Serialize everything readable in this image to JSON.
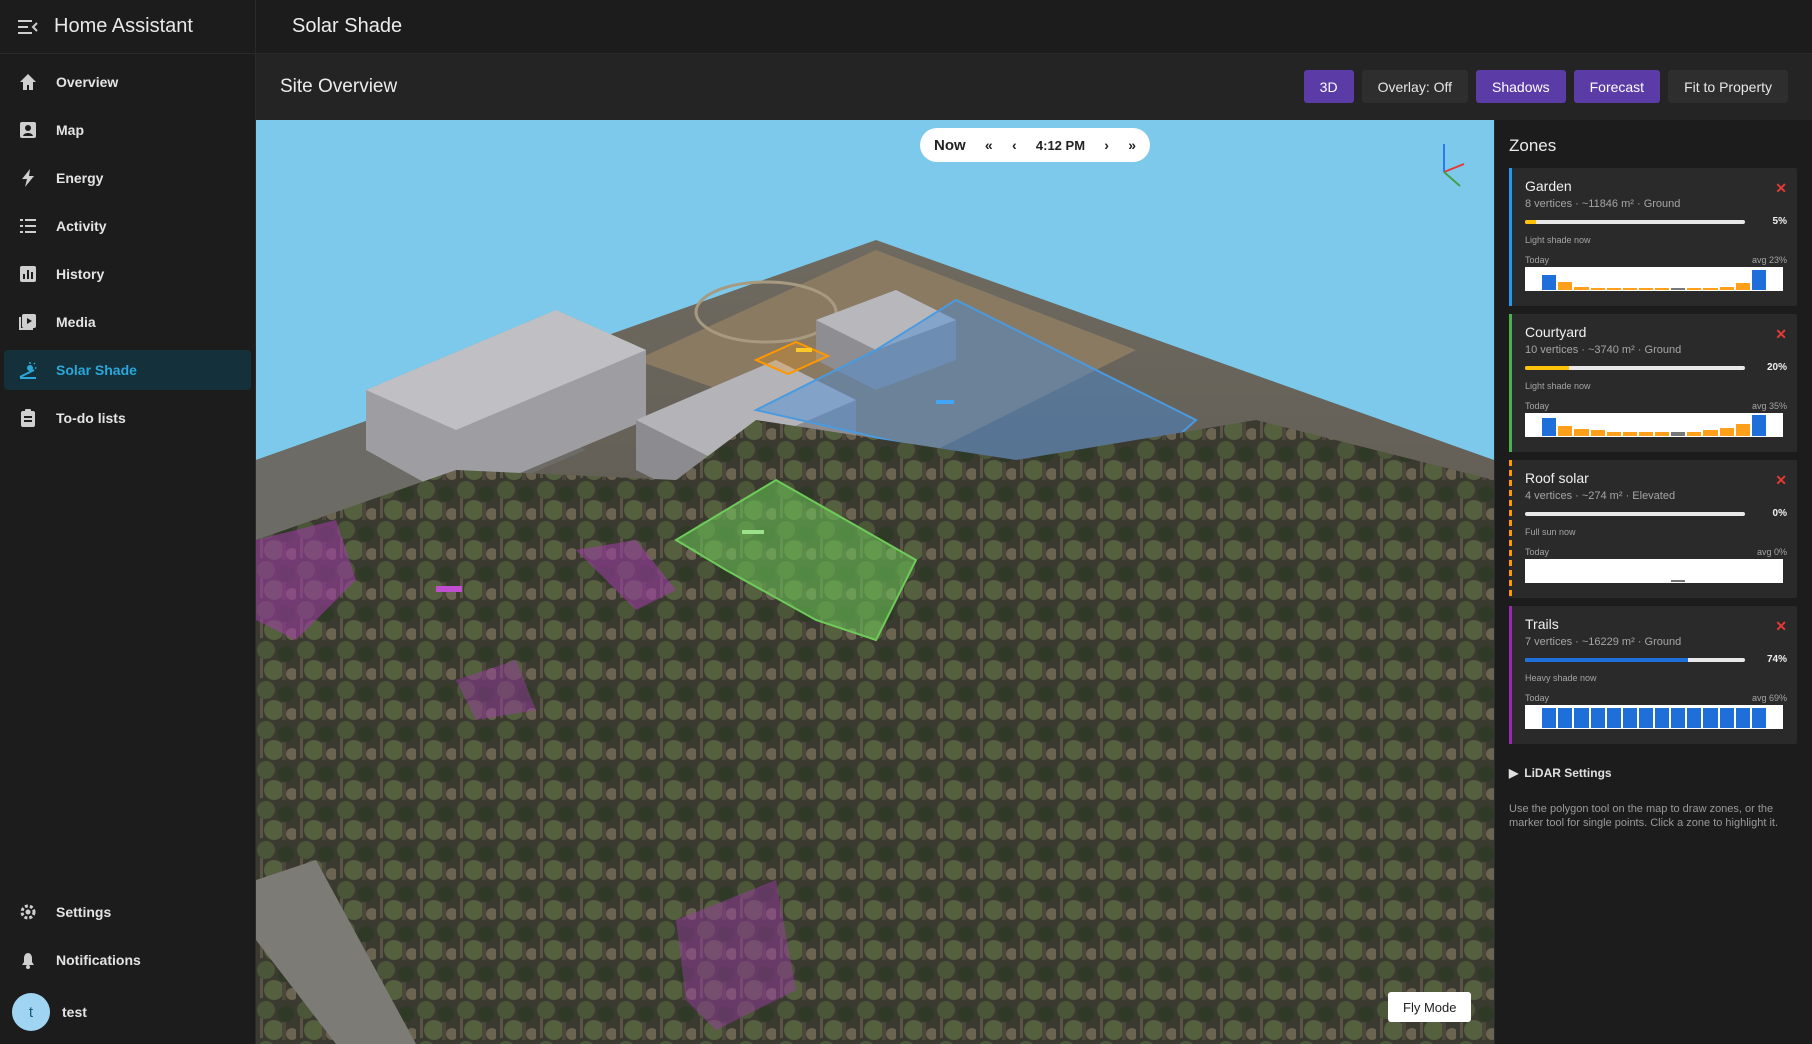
{
  "app": {
    "title": "Home Assistant"
  },
  "sidebar": {
    "items": [
      {
        "label": "Overview",
        "icon": "home-icon"
      },
      {
        "label": "Map",
        "icon": "map-icon"
      },
      {
        "label": "Energy",
        "icon": "lightning-icon"
      },
      {
        "label": "Activity",
        "icon": "list-icon"
      },
      {
        "label": "History",
        "icon": "chart-icon"
      },
      {
        "label": "Media",
        "icon": "media-icon"
      },
      {
        "label": "Solar Shade",
        "icon": "sun-shade-icon",
        "active": true
      },
      {
        "label": "To-do lists",
        "icon": "clipboard-icon"
      }
    ],
    "bottom": [
      {
        "label": "Settings",
        "icon": "gear-icon"
      },
      {
        "label": "Notifications",
        "icon": "bell-icon"
      }
    ],
    "user": {
      "initial": "t",
      "name": "test"
    }
  },
  "topbar": {
    "title": "Solar Shade"
  },
  "subbar": {
    "title": "Site Overview",
    "buttons": [
      {
        "label": "3D",
        "style": "purple"
      },
      {
        "label": "Overlay: Off",
        "style": "plain"
      },
      {
        "label": "Shadows",
        "style": "purple"
      },
      {
        "label": "Forecast",
        "style": "purple"
      },
      {
        "label": "Fit to Property",
        "style": "plain"
      }
    ]
  },
  "timebar": {
    "now": "Now",
    "fast_back": "«",
    "back": "‹",
    "time": "4:12 PM",
    "forward": "›",
    "fast_forward": "»"
  },
  "map": {
    "fly_mode": "Fly Mode"
  },
  "panel": {
    "title": "Zones",
    "zones": [
      {
        "name": "Garden",
        "meta": "8 vertices · ~11846 m² · Ground",
        "percent": 5,
        "pct_label": "5%",
        "status": "Light shade now",
        "today": "Today",
        "avg": "avg 23%",
        "color": "#2196f3",
        "fill": "#ffc107",
        "dashed": false,
        "spark": [
          {
            "v": 0.0,
            "c": "b"
          },
          {
            "v": 0.7,
            "c": "b"
          },
          {
            "v": 0.35,
            "c": "o"
          },
          {
            "v": 0.15,
            "c": "o"
          },
          {
            "v": 0.1,
            "c": "o"
          },
          {
            "v": 0.05,
            "c": "o"
          },
          {
            "v": 0.05,
            "c": "o"
          },
          {
            "v": 0.05,
            "c": "o"
          },
          {
            "v": 0.05,
            "c": "o"
          },
          {
            "v": 0.05,
            "c": "g"
          },
          {
            "v": 0.08,
            "c": "o"
          },
          {
            "v": 0.1,
            "c": "o"
          },
          {
            "v": 0.15,
            "c": "o"
          },
          {
            "v": 0.3,
            "c": "o"
          },
          {
            "v": 0.9,
            "c": "b"
          },
          {
            "v": 0.0,
            "c": "b"
          }
        ]
      },
      {
        "name": "Courtyard",
        "meta": "10 vertices · ~3740 m² · Ground",
        "percent": 20,
        "pct_label": "20%",
        "status": "Light shade now",
        "today": "Today",
        "avg": "avg 35%",
        "color": "#4caf50",
        "fill": "#ffc107",
        "dashed": false,
        "spark": [
          {
            "v": 0.0,
            "c": "b"
          },
          {
            "v": 0.8,
            "c": "b"
          },
          {
            "v": 0.45,
            "c": "o"
          },
          {
            "v": 0.3,
            "c": "o"
          },
          {
            "v": 0.25,
            "c": "o"
          },
          {
            "v": 0.2,
            "c": "o"
          },
          {
            "v": 0.2,
            "c": "o"
          },
          {
            "v": 0.2,
            "c": "o"
          },
          {
            "v": 0.2,
            "c": "o"
          },
          {
            "v": 0.2,
            "c": "g"
          },
          {
            "v": 0.2,
            "c": "o"
          },
          {
            "v": 0.25,
            "c": "o"
          },
          {
            "v": 0.35,
            "c": "o"
          },
          {
            "v": 0.55,
            "c": "o"
          },
          {
            "v": 0.95,
            "c": "b"
          },
          {
            "v": 0.0,
            "c": "b"
          }
        ]
      },
      {
        "name": "Roof solar",
        "meta": "4 vertices · ~274 m² · Elevated",
        "percent": 0,
        "pct_label": "0%",
        "status": "Full sun now",
        "today": "Today",
        "avg": "avg 0%",
        "color": "#ff9800",
        "fill": "#ffc107",
        "dashed": true,
        "spark": [
          {
            "v": 0,
            "c": "o"
          },
          {
            "v": 0,
            "c": "o"
          },
          {
            "v": 0,
            "c": "o"
          },
          {
            "v": 0,
            "c": "o"
          },
          {
            "v": 0,
            "c": "o"
          },
          {
            "v": 0,
            "c": "o"
          },
          {
            "v": 0,
            "c": "o"
          },
          {
            "v": 0,
            "c": "o"
          },
          {
            "v": 0,
            "c": "o"
          },
          {
            "v": 0.06,
            "c": "g"
          },
          {
            "v": 0,
            "c": "o"
          },
          {
            "v": 0,
            "c": "o"
          },
          {
            "v": 0,
            "c": "o"
          },
          {
            "v": 0,
            "c": "o"
          },
          {
            "v": 0,
            "c": "o"
          },
          {
            "v": 0,
            "c": "o"
          }
        ]
      },
      {
        "name": "Trails",
        "meta": "7 vertices · ~16229 m² · Ground",
        "percent": 74,
        "pct_label": "74%",
        "status": "Heavy shade now",
        "today": "Today",
        "avg": "avg 69%",
        "color": "#9c27b0",
        "fill": "#1e6fd9",
        "dashed": false,
        "spark": [
          {
            "v": 0.0,
            "c": "b"
          },
          {
            "v": 0.9,
            "c": "b"
          },
          {
            "v": 0.9,
            "c": "b"
          },
          {
            "v": 0.9,
            "c": "b"
          },
          {
            "v": 0.9,
            "c": "b"
          },
          {
            "v": 0.9,
            "c": "b"
          },
          {
            "v": 0.9,
            "c": "b"
          },
          {
            "v": 0.9,
            "c": "b"
          },
          {
            "v": 0.9,
            "c": "b"
          },
          {
            "v": 0.9,
            "c": "b"
          },
          {
            "v": 0.9,
            "c": "b"
          },
          {
            "v": 0.9,
            "c": "b"
          },
          {
            "v": 0.9,
            "c": "b"
          },
          {
            "v": 0.9,
            "c": "b"
          },
          {
            "v": 0.9,
            "c": "b"
          },
          {
            "v": 0.0,
            "c": "b"
          }
        ]
      }
    ],
    "lidar_label": "LiDAR Settings",
    "help": "Use the polygon tool on the map to draw zones, or the marker tool for single points. Click a zone to highlight it."
  },
  "colors": {
    "accent": "#2ba7d9",
    "purple_button": "#5b3ba6",
    "close": "#e53935"
  }
}
